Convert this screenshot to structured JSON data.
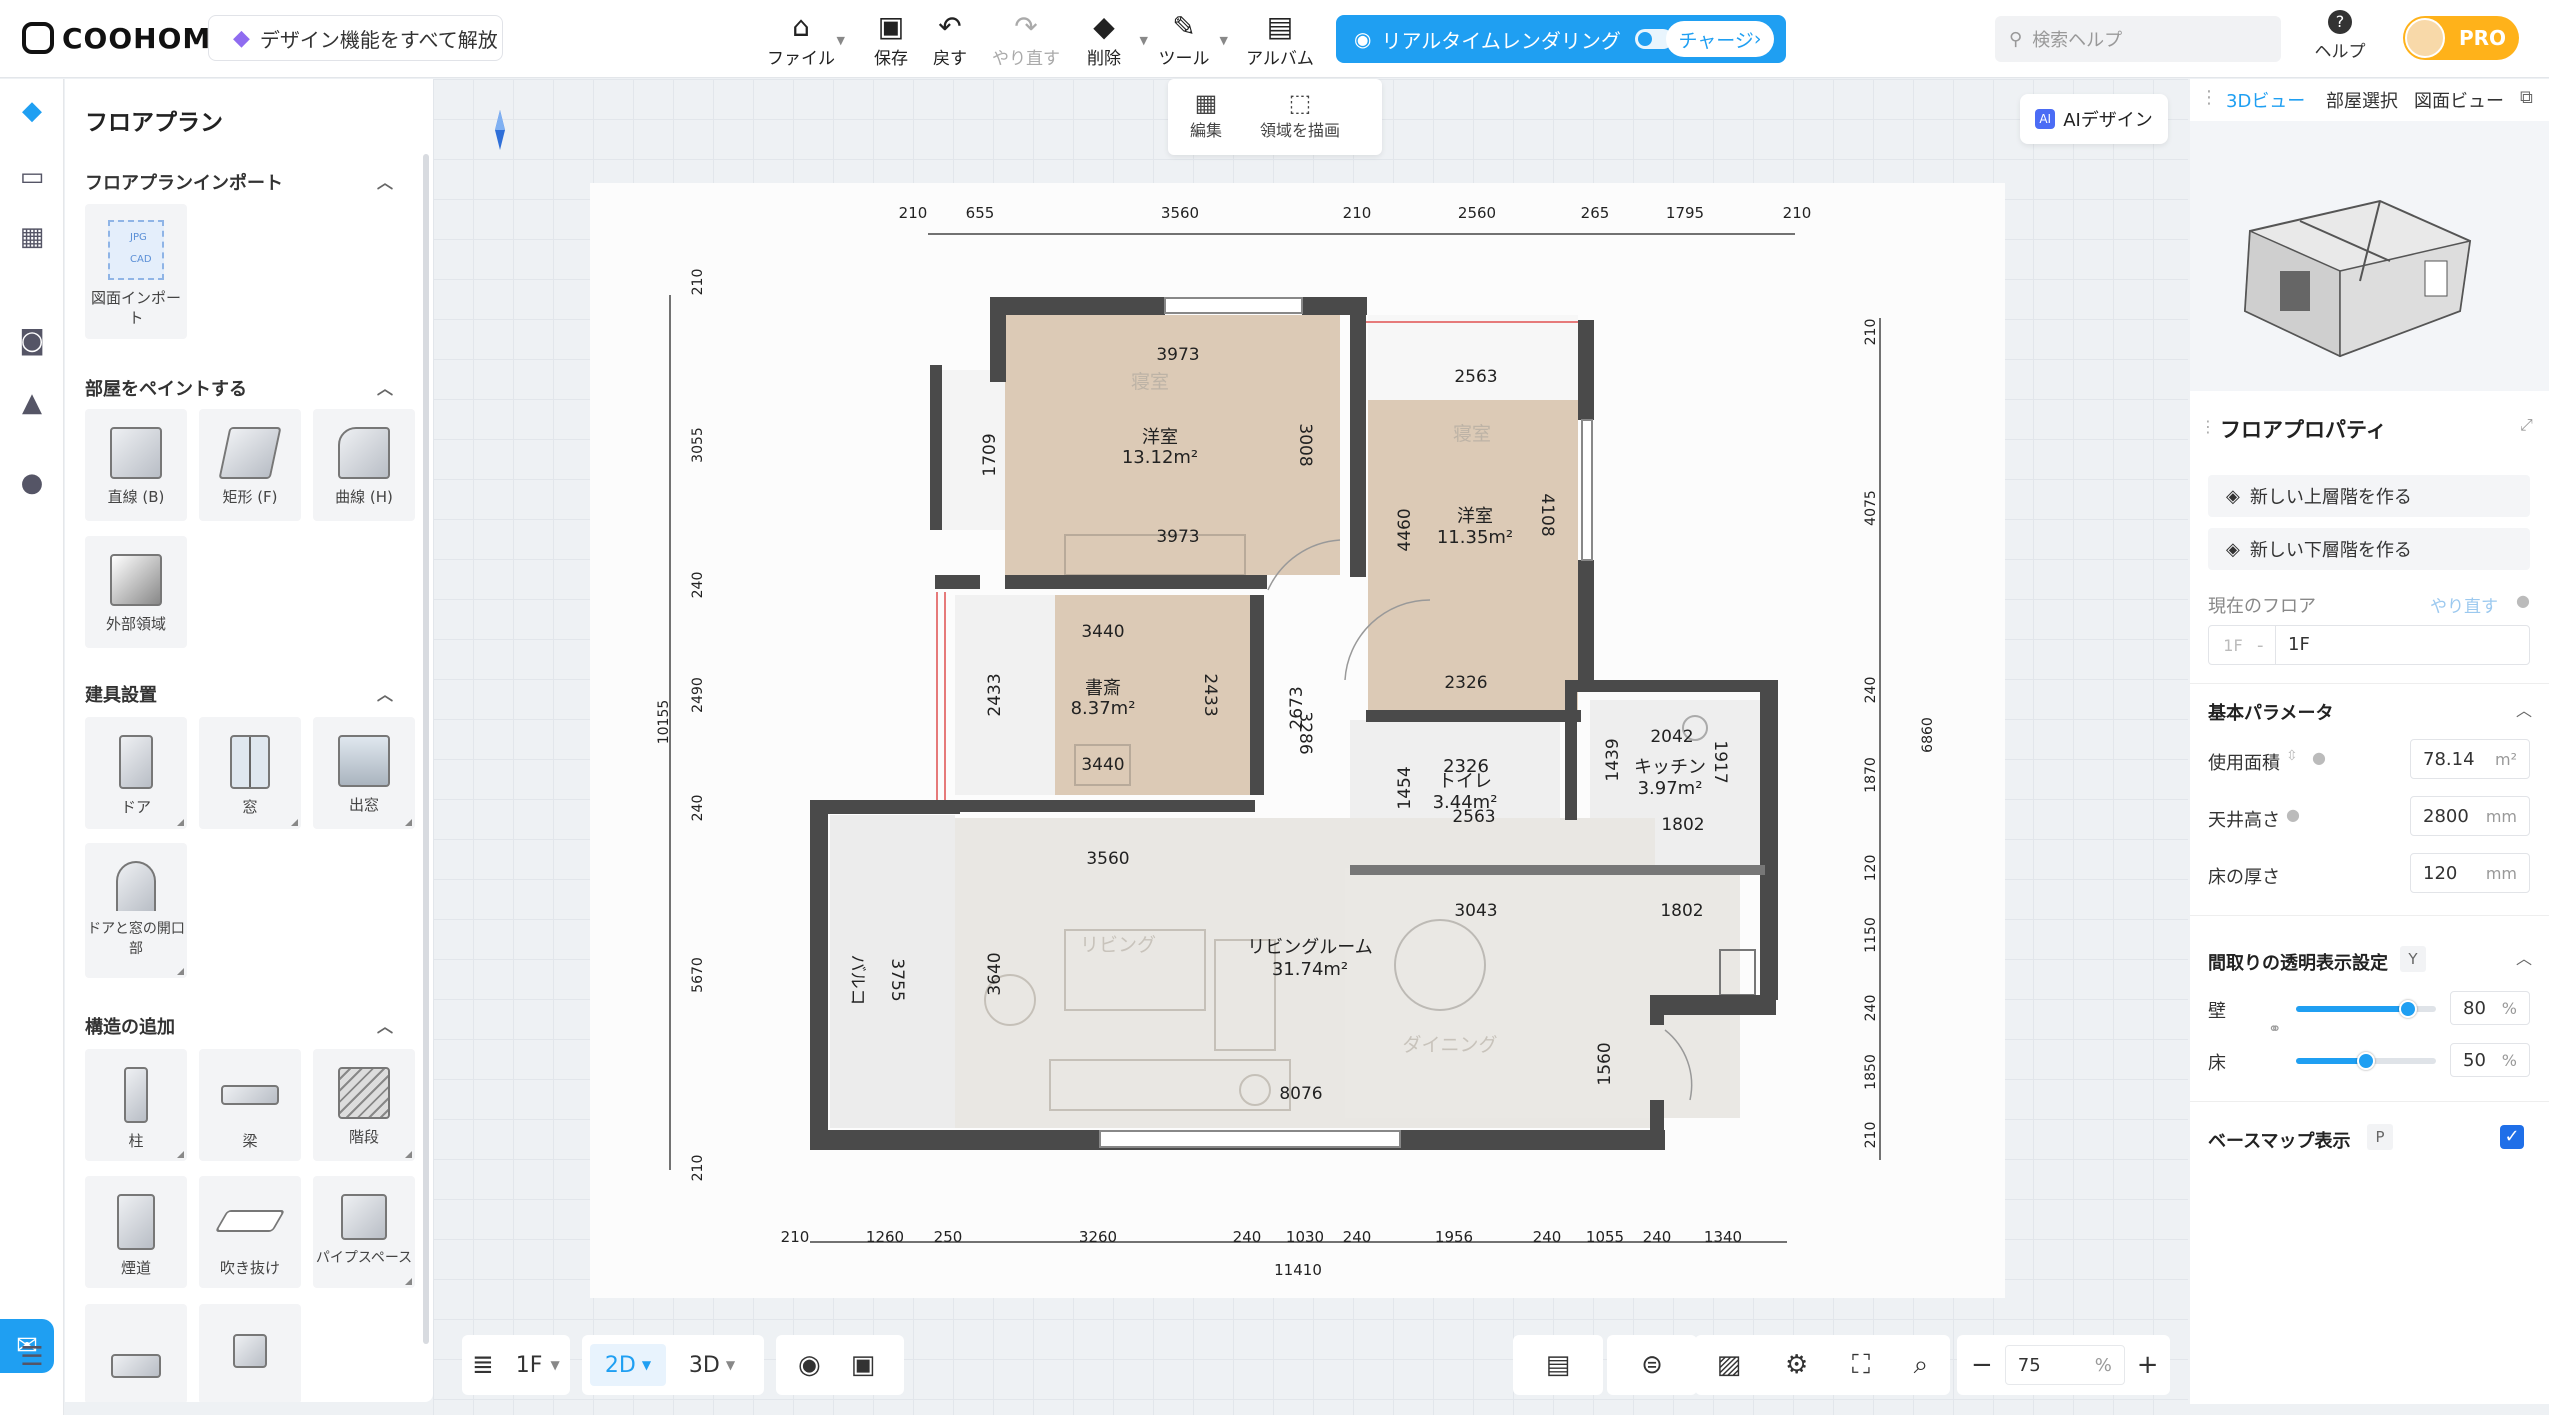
{
  "topbar": {
    "logo": "COOHOM",
    "unlock": "デザイン機能をすべて解放",
    "tools": [
      {
        "label": "ファイル"
      },
      {
        "label": "保存"
      },
      {
        "label": "戻す"
      },
      {
        "label": "やり直す"
      },
      {
        "label": "削除"
      },
      {
        "label": "ツール"
      },
      {
        "label": "アルバム"
      }
    ],
    "render": "リアルタイムレンダリング",
    "charge": "チャージ",
    "search_placeholder": "検索ヘルプ",
    "help": "ヘルプ",
    "pro": "PRO"
  },
  "leftpanel": {
    "title": "フロアプラン",
    "sec_import": "フロアプランインポート",
    "import_tile": "図面インポート",
    "import_badges": [
      "JPG",
      "CAD"
    ],
    "sec_paint": "部屋をペイントする",
    "paint_tiles": [
      "直線 (B)",
      "矩形 (F)",
      "曲線 (H)",
      "外部領域"
    ],
    "sec_fittings": "建具設置",
    "fitting_tiles": [
      "ドア",
      "窓",
      "出窓",
      "ドアと窓の開口部"
    ],
    "sec_structure": "構造の追加",
    "structure_tiles": [
      "柱",
      "梁",
      "階段",
      "煙道",
      "吹き抜け",
      "パイプスペース"
    ]
  },
  "editbar": {
    "edit": "編集",
    "draw": "領域を描画"
  },
  "aidesign": "AIデザイン",
  "plan": {
    "rooms": [
      {
        "name": "洋室",
        "area": "13.12m²",
        "ghost": "寝室"
      },
      {
        "name": "洋室",
        "area": "11.35m²",
        "ghost": "寝室"
      },
      {
        "name": "書斎",
        "area": "8.37m²"
      },
      {
        "name": "トイレ",
        "area": "3.44m²",
        "dim": "2326"
      },
      {
        "name": "キッチン",
        "area": "3.97m²"
      },
      {
        "name": "リビングルーム",
        "area": "31.74m²",
        "ghost": "リビング"
      }
    ],
    "ghost_dining": "ダイニング",
    "balcony": "バルコ",
    "top_dims": [
      "210",
      "655",
      "3560",
      "210",
      "2560",
      "265",
      "1795",
      "210"
    ],
    "bottom_dims": [
      "210",
      "1260",
      "250",
      "3260",
      "240",
      "1030",
      "240",
      "1956",
      "240",
      "1055",
      "240",
      "1340"
    ],
    "bottom_total": "11410",
    "left_dims": [
      "210",
      "3055",
      "240",
      "2490",
      "240",
      "5670",
      "210"
    ],
    "left_total": "10155",
    "right_dims": [
      "210",
      "4075",
      "240",
      "1870",
      "120",
      "1150",
      "240",
      "1850",
      "210"
    ],
    "right_total": "6860",
    "inner_dims": {
      "d3973": "3973",
      "d1709": "1709",
      "d3008": "3008",
      "d2563": "2563",
      "d4460": "4460",
      "d4108": "4108",
      "d2326": "2326",
      "d3440": "3440",
      "d2433": "2433",
      "d2673": "2673",
      "d3286": "3286",
      "d1454": "1454",
      "d1439": "1439",
      "d2042": "2042",
      "d1917": "1917",
      "d1802": "1802",
      "d3560": "3560",
      "d3043": "3043",
      "d3640": "3640",
      "d3755": "3755",
      "d1560": "1560",
      "d8076": "8076"
    }
  },
  "bottombar": {
    "floor": "1F",
    "mode2d": "2D",
    "mode3d": "3D",
    "zoom_value": "75",
    "zoom_unit": "%"
  },
  "rightpanel": {
    "tabs": [
      "3Dビュー",
      "部屋選択",
      "図面ビュー"
    ],
    "title": "フロアプロパティ",
    "btn_up": "新しい上層階を作る",
    "btn_down": "新しい下層階を作る",
    "current_floor_label": "現在のフロア",
    "redo": "やり直す",
    "floor_prefix": "1F",
    "floor_value": "1F",
    "basic_params": "基本パラメータ",
    "area_label": "使用面積",
    "area_value": "78.14",
    "area_unit": "m²",
    "ceiling_label": "天井高さ",
    "ceiling_value": "2800",
    "ceiling_unit": "mm",
    "floor_thick_label": "床の厚さ",
    "floor_thick_value": "120",
    "floor_thick_unit": "mm",
    "transparency_label": "間取りの透明表示設定",
    "transparency_key": "Y",
    "wall_label": "壁",
    "wall_value": "80",
    "wall_fraction": 0.8,
    "floor_label": "床",
    "floor_opacity_value": "50",
    "floor_fraction": 0.5,
    "percent": "%",
    "basemap_label": "ベースマップ表示",
    "basemap_key": "P"
  },
  "colors": {
    "accent": "#1f9ff2",
    "pro": "#ffb21a",
    "wall": "#4a4a4a",
    "wood": "#dcc9b4"
  }
}
